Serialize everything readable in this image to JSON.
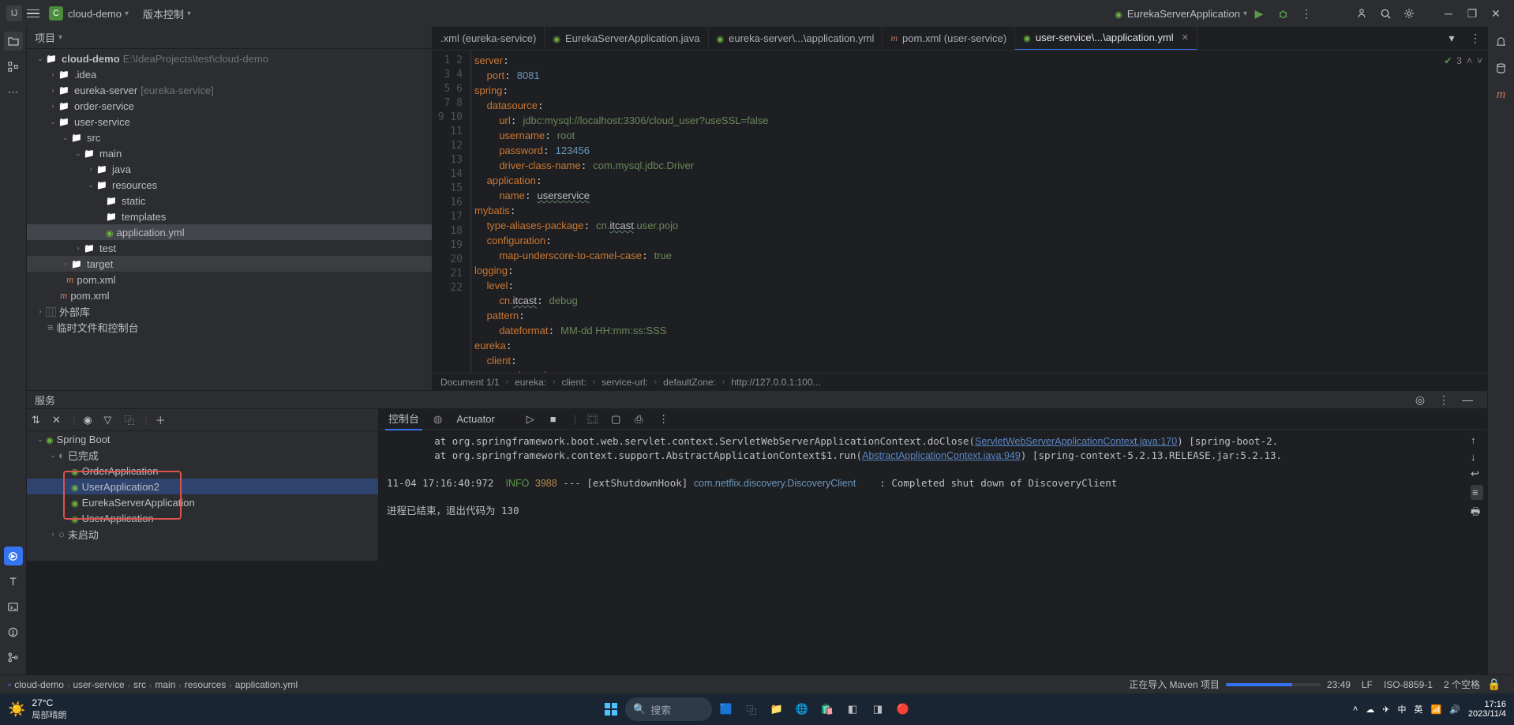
{
  "topbar": {
    "project_name": "cloud-demo",
    "vcs_label": "版本控制",
    "run_config": "EurekaServerApplication"
  },
  "project_panel": {
    "title": "项目",
    "tree": {
      "root": "cloud-demo",
      "root_path": "E:\\IdeaProjects\\test\\cloud-demo",
      "idea": ".idea",
      "eureka": "eureka-server",
      "eureka_hint": "[eureka-service]",
      "order": "order-service",
      "user": "user-service",
      "src": "src",
      "main": "main",
      "java": "java",
      "resources": "resources",
      "static": "static",
      "templates": "templates",
      "app_yml": "application.yml",
      "test": "test",
      "target": "target",
      "pom1": "pom.xml",
      "pom2": "pom.xml",
      "ext_lib": "外部库",
      "scratch": "临时文件和控制台"
    }
  },
  "tabs": [
    {
      "label": ".xml (eureka-service)"
    },
    {
      "label": "EurekaServerApplication.java"
    },
    {
      "label": "eureka-server\\...\\application.yml"
    },
    {
      "label": "pom.xml (user-service)"
    },
    {
      "label": "user-service\\...\\application.yml"
    }
  ],
  "inspection_count": "3",
  "code_lines": [
    [
      [
        "k-key",
        "server"
      ],
      [
        "",
        ":"
      ]
    ],
    [
      [
        "",
        "  "
      ],
      [
        "k-key",
        "port"
      ],
      [
        "",
        ": "
      ],
      [
        "k-num",
        "8081"
      ]
    ],
    [
      [
        "k-key",
        "spring"
      ],
      [
        "",
        ":"
      ]
    ],
    [
      [
        "",
        "  "
      ],
      [
        "k-key",
        "datasource"
      ],
      [
        "",
        ":"
      ]
    ],
    [
      [
        "",
        "    "
      ],
      [
        "k-key",
        "url"
      ],
      [
        "",
        ": "
      ],
      [
        "k-str",
        "jdbc:mysql://localhost:3306/cloud_user?useSSL=false"
      ]
    ],
    [
      [
        "",
        "    "
      ],
      [
        "k-key",
        "username"
      ],
      [
        "",
        ": "
      ],
      [
        "k-str",
        "root"
      ]
    ],
    [
      [
        "",
        "    "
      ],
      [
        "k-key",
        "password"
      ],
      [
        "",
        ": "
      ],
      [
        "k-num",
        "123456"
      ]
    ],
    [
      [
        "",
        "    "
      ],
      [
        "k-key",
        "driver-class-name"
      ],
      [
        "",
        ": "
      ],
      [
        "k-str",
        "com.mysql.jdbc.Driver"
      ]
    ],
    [
      [
        "",
        "  "
      ],
      [
        "k-key",
        "application"
      ],
      [
        "",
        ":"
      ]
    ],
    [
      [
        "",
        "    "
      ],
      [
        "k-key",
        "name"
      ],
      [
        "",
        ": "
      ],
      [
        "und",
        "userservice"
      ]
    ],
    [
      [
        "k-key",
        "mybatis"
      ],
      [
        "",
        ":"
      ]
    ],
    [
      [
        "",
        "  "
      ],
      [
        "k-key",
        "type-aliases-package"
      ],
      [
        "",
        ": "
      ],
      [
        "k-str",
        "cn."
      ],
      [
        "und",
        "itcast"
      ],
      [
        "k-str",
        ".user.pojo"
      ]
    ],
    [
      [
        "",
        "  "
      ],
      [
        "k-key",
        "configuration"
      ],
      [
        "",
        ":"
      ]
    ],
    [
      [
        "",
        "    "
      ],
      [
        "k-key",
        "map-underscore-to-camel-case"
      ],
      [
        "",
        ": "
      ],
      [
        "k-str",
        "true"
      ]
    ],
    [
      [
        "k-key",
        "logging"
      ],
      [
        "",
        ":"
      ]
    ],
    [
      [
        "",
        "  "
      ],
      [
        "k-key",
        "level"
      ],
      [
        "",
        ":"
      ]
    ],
    [
      [
        "",
        "    "
      ],
      [
        "k-key",
        "cn."
      ],
      [
        "und",
        "itcast"
      ],
      [
        "",
        ": "
      ],
      [
        "k-str",
        "debug"
      ]
    ],
    [
      [
        "",
        "  "
      ],
      [
        "k-key",
        "pattern"
      ],
      [
        "",
        ":"
      ]
    ],
    [
      [
        "",
        "    "
      ],
      [
        "k-key",
        "dateformat"
      ],
      [
        "",
        ": "
      ],
      [
        "k-str",
        "MM-dd HH:mm:ss:SSS"
      ]
    ],
    [
      [
        "k-key",
        "eureka"
      ],
      [
        "",
        ":"
      ]
    ],
    [
      [
        "",
        "  "
      ],
      [
        "k-key",
        "client"
      ],
      [
        "",
        ":"
      ]
    ],
    [
      [
        "",
        "    "
      ],
      [
        "k-key",
        "service-url"
      ],
      [
        "",
        ":"
      ]
    ]
  ],
  "breadcrumb_editor": [
    "Document 1/1",
    "eureka:",
    "client:",
    "service-url:",
    "defaultZone:",
    "http://127.0.0.1:100..."
  ],
  "services": {
    "title": "服务",
    "spring_boot": "Spring Boot",
    "done": "已完成",
    "not_started": "未启动",
    "apps": [
      "OrderApplication",
      "UserApplication2",
      "EurekaServerApplication",
      "UserApplication"
    ]
  },
  "console": {
    "tab_console": "控制台",
    "tab_actuator": "Actuator",
    "lines": [
      "        at org.springframework.boot.web.servlet.context.ServletWebServerApplicationContext.doClose(<a>ServletWebServerApplicationContext.java:170</a>) [spring-boot-2.",
      "        at org.springframework.context.support.AbstractApplicationContext$1.run(<a>AbstractApplicationContext.java:949</a>) [spring-context-5.2.13.RELEASE.jar:5.2.13.",
      "",
      "11-04 17:16:40:972  <i>INFO</i> <p>3988</p> --- [extShutdownHook] <c>com.netflix.discovery.DiscoveryClient</c>    : Completed shut down of DiscoveryClient",
      "",
      "进程已结束，退出代码为 130"
    ]
  },
  "status": {
    "breadcrumb": [
      "cloud-demo",
      "user-service",
      "src",
      "main",
      "resources",
      "application.yml"
    ],
    "importing": "正在导入 Maven 项目",
    "pos": "23:49",
    "sep": "LF",
    "enc": "ISO-8859-1",
    "indent": "2 个空格"
  },
  "taskbar": {
    "temp": "27°C",
    "weather": "局部晴朗",
    "search": "搜索",
    "time": "17:16",
    "date": "2023/11/4",
    "ime1": "中",
    "ime2": "英"
  }
}
